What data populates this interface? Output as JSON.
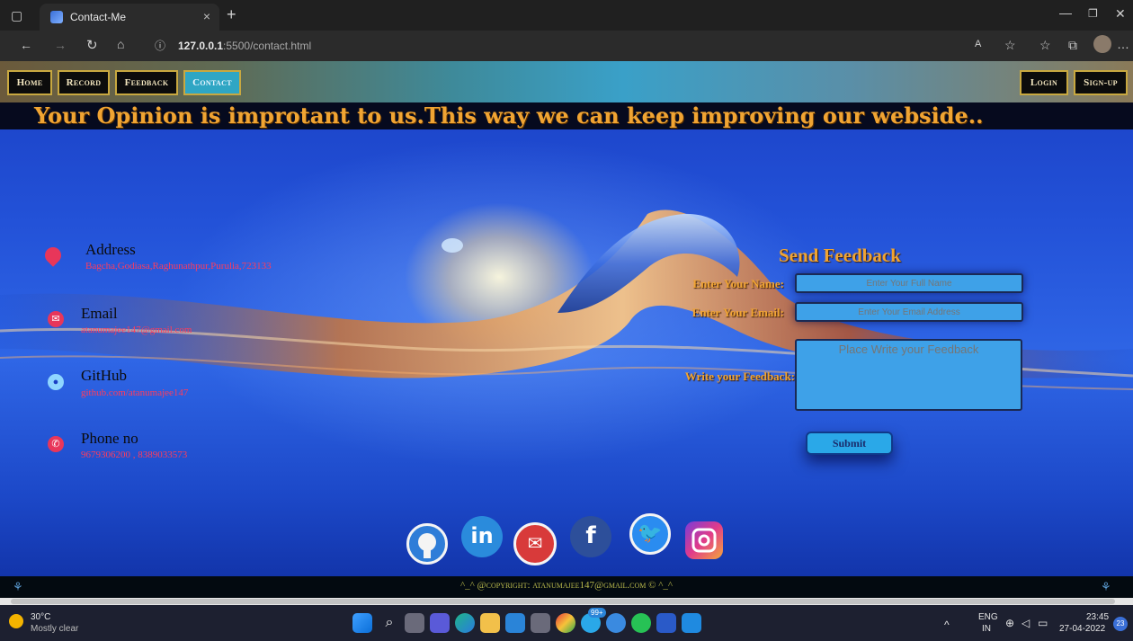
{
  "browser": {
    "tab_title": "Contact-Me",
    "tab_close": "×",
    "new_tab": "+",
    "url_host": "127.0.0.1",
    "url_rest": ":5500/contact.html"
  },
  "nav": {
    "left": [
      "Home",
      "Record",
      "Feedback",
      "Contact"
    ],
    "right": [
      "Login",
      "Sign-up"
    ],
    "active": "Contact"
  },
  "headline": "Your Opinion is improtant to us.This way we can keep improving our webside..",
  "contact": {
    "address_title": "Address",
    "address_value": "Bagcha,Godiasa,Raghunathpur,Purulia,723133",
    "email_title": "Email",
    "email_value": "atanumajee147@gmail.com",
    "github_title": "GitHub",
    "github_value": "github.com/atanumajee147",
    "phone_title": "Phone no",
    "phone_value": "9679306200 , 8389033573"
  },
  "form": {
    "title": "Send Feedback",
    "name_label": "Enter Your Name:",
    "name_placeholder": "Enter Your Full Name",
    "email_label": "Enter Your Email:",
    "email_placeholder": "Enter Your Email Address",
    "feedback_label": "Write your Feedback:",
    "feedback_placeholder": "Place Write your Feedback",
    "submit": "Submit"
  },
  "social": {
    "linkedin": "in",
    "facebook": "f"
  },
  "footer": "^_^ @copyright: atanumajee147@gmail.com © ^_^",
  "taskbar": {
    "weather_temp": "30°C",
    "weather_desc": "Mostly clear",
    "lang_top": "ENG",
    "lang_bottom": "IN",
    "time": "23:45",
    "date": "27-04-2022",
    "notif_badge": "23",
    "mail_badge": "99+"
  }
}
